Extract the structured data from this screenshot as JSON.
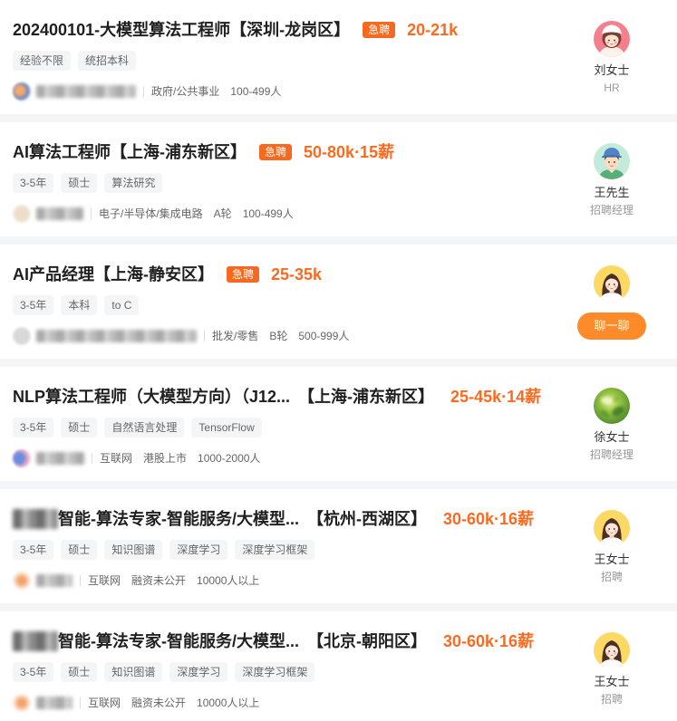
{
  "jobs": [
    {
      "title": "202400101-大模型算法工程师",
      "area": "【深圳-龙岗区】",
      "badge": "急聘",
      "salary": "20-21k",
      "tags": [
        "经验不限",
        "统招本科"
      ],
      "company_info": [
        "政府/公共事业",
        "100-499人"
      ],
      "hr_name": "刘女士",
      "hr_title": "HR",
      "avatar": "cartoon-woman-pink-avatar"
    },
    {
      "title": "AI算法工程师",
      "area": "【上海-浦东新区】",
      "badge": "急聘",
      "salary": "50-80k·15薪",
      "tags": [
        "3-5年",
        "硕士",
        "算法研究"
      ],
      "company_info": [
        "电子/半导体/集成电路",
        "A轮",
        "100-499人"
      ],
      "hr_name": "王先生",
      "hr_title": "招聘经理",
      "avatar": "cartoon-man-cap-avatar"
    },
    {
      "title": "AI产品经理",
      "area": "【上海-静安区】",
      "badge": "急聘",
      "salary": "25-35k",
      "tags": [
        "3-5年",
        "本科",
        "to C"
      ],
      "company_info": [
        "批发/零售",
        "B轮",
        "500-999人"
      ],
      "chat_button": "聊一聊",
      "avatar": "cartoon-woman-yellow-avatar"
    },
    {
      "title": "NLP算法工程师（大模型方向）（J12...",
      "area": "【上海-浦东新区】",
      "salary": "25-45k·14薪",
      "tags": [
        "3-5年",
        "硕士",
        "自然语言处理",
        "TensorFlow"
      ],
      "company_info": [
        "互联网",
        "港股上市",
        "1000-2000人"
      ],
      "hr_name": "徐女士",
      "hr_title": "招聘经理",
      "avatar": "plant-photo-avatar"
    },
    {
      "title": "智能-算法专家-智能服务/大模型...",
      "area": "【杭州-西湖区】",
      "salary": "30-60k·16薪",
      "tags": [
        "3-5年",
        "硕士",
        "知识图谱",
        "深度学习",
        "深度学习框架"
      ],
      "company_info": [
        "互联网",
        "融资未公开",
        "10000人以上"
      ],
      "hr_name": "王女士",
      "hr_title": "招聘",
      "avatar": "cartoon-woman-yellow-avatar"
    },
    {
      "title": "智能-算法专家-智能服务/大模型...",
      "area": "【北京-朝阳区】",
      "salary": "30-60k·16薪",
      "tags": [
        "3-5年",
        "硕士",
        "知识图谱",
        "深度学习",
        "深度学习框架"
      ],
      "company_info": [
        "互联网",
        "融资未公开",
        "10000人以上"
      ],
      "hr_name": "王女士",
      "hr_title": "招聘",
      "avatar": "cartoon-woman-yellow-avatar"
    }
  ],
  "colors": {
    "salary": "#fa6a21",
    "urgent_badge": "#f7691f",
    "chat_button": "#ff8a2a",
    "tag_background": "#f3f5f7",
    "page_background": "#f4f5f7",
    "card_background": "#ffffff"
  }
}
